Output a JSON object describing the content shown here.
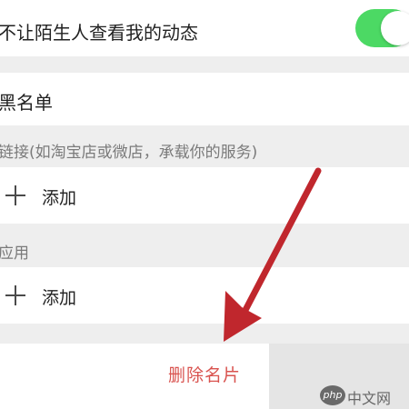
{
  "privacy": {
    "hide_from_strangers_label": "不让陌生人查看我的动态",
    "hide_from_strangers_enabled": true
  },
  "blacklist": {
    "label": "黑名单"
  },
  "links": {
    "section_label": "链接(如淘宝店或微店，承载你的服务)",
    "add_label": "添加"
  },
  "apps": {
    "section_label": "应用",
    "add_label": "添加"
  },
  "actions": {
    "delete_card_label": "删除名片"
  },
  "watermark": {
    "logo_text": "php",
    "site_text": "中文网"
  },
  "colors": {
    "toggle_on": "#4cd964",
    "delete_text": "#d9534f",
    "arrow": "#c0272d"
  }
}
